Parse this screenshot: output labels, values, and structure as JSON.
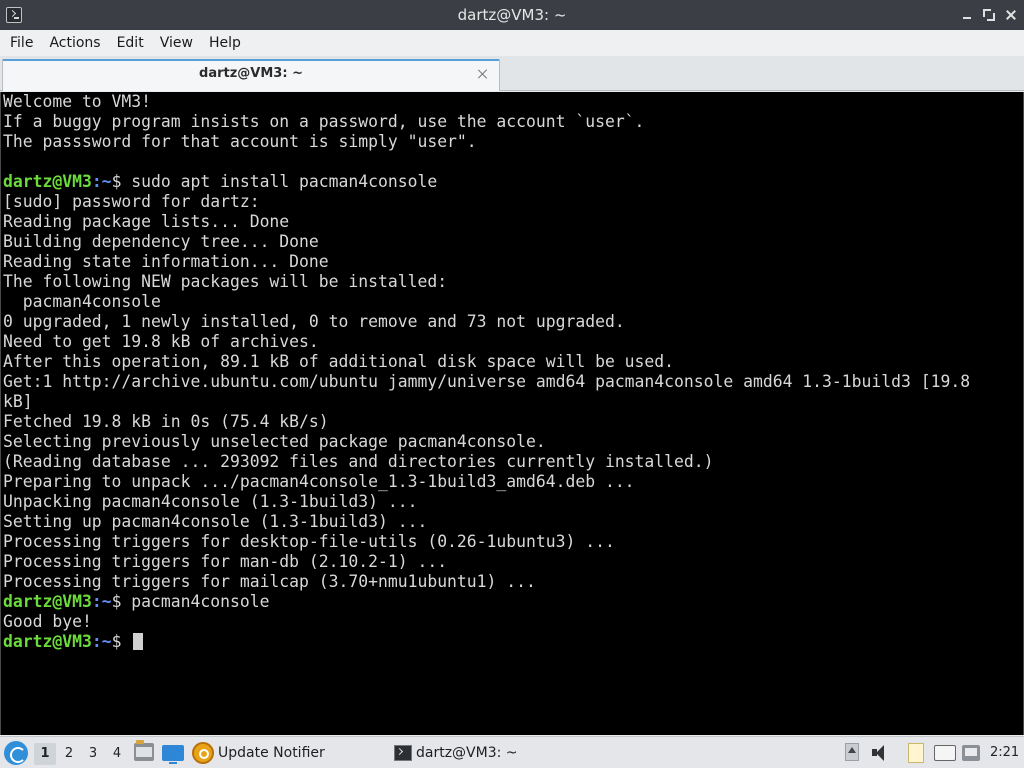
{
  "window": {
    "title": "dartz@VM3: ~"
  },
  "menu": [
    "File",
    "Actions",
    "Edit",
    "View",
    "Help"
  ],
  "tab": {
    "title": "dartz@VM3: ~"
  },
  "terminal": {
    "prompt_user": "dartz@VM3",
    "prompt_path": ":~",
    "prompt_symbol": "$",
    "lines": [
      {
        "type": "out",
        "text": "Welcome to VM3!"
      },
      {
        "type": "out",
        "text": "If a buggy program insists on a password, use the account `user`."
      },
      {
        "type": "out",
        "text": "The passsword for that account is simply \"user\"."
      },
      {
        "type": "out",
        "text": ""
      },
      {
        "type": "cmd",
        "text": " sudo apt install pacman4console"
      },
      {
        "type": "out",
        "text": "[sudo] password for dartz:"
      },
      {
        "type": "out",
        "text": "Reading package lists... Done"
      },
      {
        "type": "out",
        "text": "Building dependency tree... Done"
      },
      {
        "type": "out",
        "text": "Reading state information... Done"
      },
      {
        "type": "out",
        "text": "The following NEW packages will be installed:"
      },
      {
        "type": "out",
        "text": "  pacman4console"
      },
      {
        "type": "out",
        "text": "0 upgraded, 1 newly installed, 0 to remove and 73 not upgraded."
      },
      {
        "type": "out",
        "text": "Need to get 19.8 kB of archives."
      },
      {
        "type": "out",
        "text": "After this operation, 89.1 kB of additional disk space will be used."
      },
      {
        "type": "out",
        "text": "Get:1 http://archive.ubuntu.com/ubuntu jammy/universe amd64 pacman4console amd64 1.3-1build3 [19.8"
      },
      {
        "type": "out",
        "text": "kB]"
      },
      {
        "type": "out",
        "text": "Fetched 19.8 kB in 0s (75.4 kB/s)"
      },
      {
        "type": "out",
        "text": "Selecting previously unselected package pacman4console."
      },
      {
        "type": "out",
        "text": "(Reading database ... 293092 files and directories currently installed.)"
      },
      {
        "type": "out",
        "text": "Preparing to unpack .../pacman4console_1.3-1build3_amd64.deb ..."
      },
      {
        "type": "out",
        "text": "Unpacking pacman4console (1.3-1build3) ..."
      },
      {
        "type": "out",
        "text": "Setting up pacman4console (1.3-1build3) ..."
      },
      {
        "type": "out",
        "text": "Processing triggers for desktop-file-utils (0.26-1ubuntu3) ..."
      },
      {
        "type": "out",
        "text": "Processing triggers for man-db (2.10.2-1) ..."
      },
      {
        "type": "out",
        "text": "Processing triggers for mailcap (3.70+nmu1ubuntu1) ..."
      },
      {
        "type": "cmd",
        "text": " pacman4console"
      },
      {
        "type": "out",
        "text": "Good bye!"
      },
      {
        "type": "prompt",
        "text": " "
      }
    ]
  },
  "taskbar": {
    "desktops": [
      "1",
      "2",
      "3",
      "4"
    ],
    "active_desktop": "1",
    "tasks": {
      "update_notifier": "Update Notifier",
      "terminal": "dartz@VM3: ~"
    },
    "clock": "2:21"
  },
  "colors": {
    "titlebar": "#3b3f45",
    "terminal_bg": "#000000",
    "prompt_user": "#6bdc3c",
    "prompt_path": "#5e8ff0",
    "tab_accent": "#5aa0d8"
  },
  "icons": {
    "app": "terminal-icon",
    "start": "start-menu-icon",
    "files": "file-manager-icon",
    "desktop": "show-desktop-icon",
    "update": "update-notifier-icon",
    "tray": [
      "tray-expand-icon",
      "volume-icon",
      "clipboard-icon",
      "keyboard-icon",
      "network-icon"
    ]
  }
}
